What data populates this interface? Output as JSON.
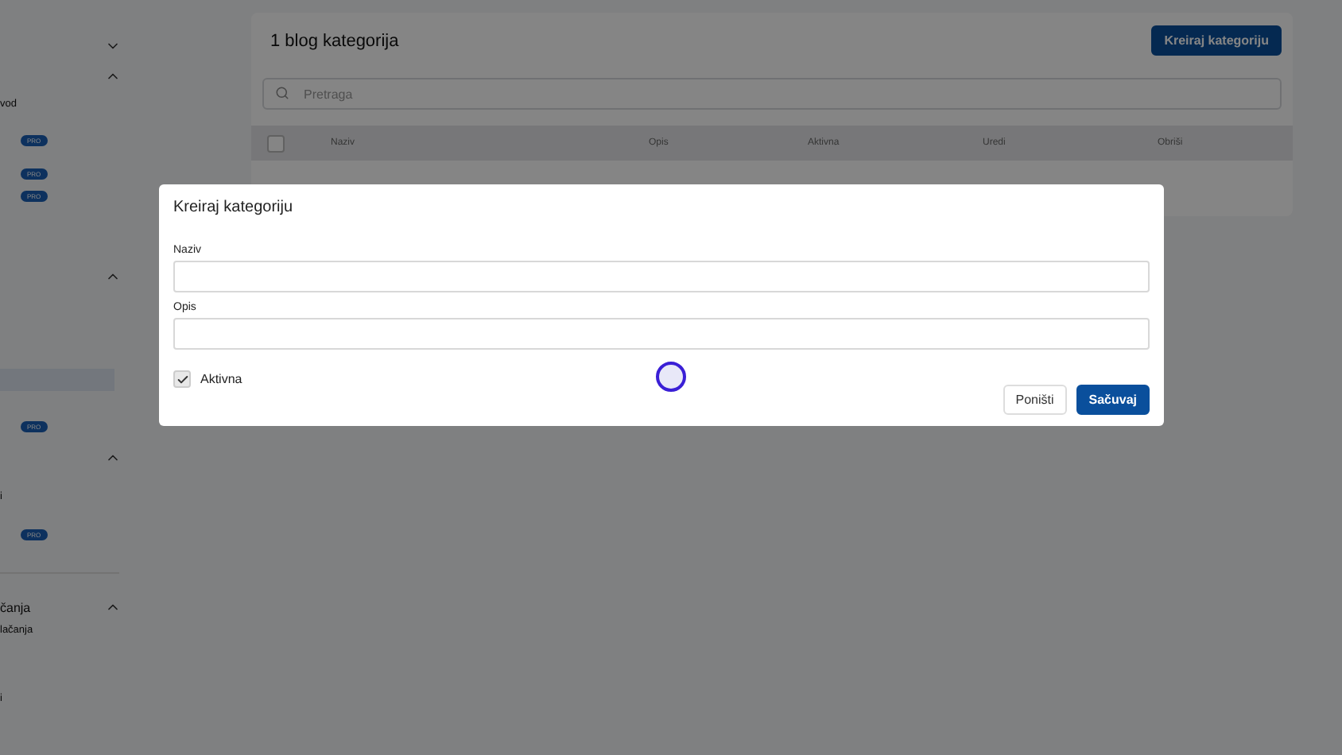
{
  "sidebar": {
    "items": [
      {
        "kind": "chevron",
        "expanded": false
      },
      {
        "kind": "chevron",
        "expanded": true
      },
      {
        "kind": "text",
        "text": "vod"
      },
      {
        "kind": "pro",
        "text": "PRO"
      },
      {
        "kind": "pro",
        "text": "PRO"
      },
      {
        "kind": "pro",
        "text": "PRO"
      },
      {
        "kind": "chevron",
        "expanded": true
      },
      {
        "kind": "highlight"
      },
      {
        "kind": "pro",
        "text": "PRO"
      },
      {
        "kind": "chevron",
        "expanded": true
      },
      {
        "kind": "text",
        "text": "i"
      },
      {
        "kind": "pro",
        "text": "PRO"
      },
      {
        "kind": "divider"
      },
      {
        "kind": "section",
        "text": "čanja"
      },
      {
        "kind": "text",
        "text": "lačanja"
      },
      {
        "kind": "text",
        "text": "i"
      }
    ]
  },
  "page": {
    "title": "1 blog kategorija",
    "create_button": "Kreiraj kategoriju",
    "search": {
      "placeholder": "Pretraga"
    },
    "table": {
      "select_all_checked": false,
      "columns": [
        "Naziv",
        "Opis",
        "Aktivna",
        "Uredi",
        "Obriši"
      ]
    }
  },
  "modal": {
    "title": "Kreiraj kategoriju",
    "fields": [
      {
        "label": "Naziv"
      },
      {
        "label": "Opis"
      }
    ],
    "active": {
      "label": "Aktivna",
      "checked": true
    },
    "buttons": [
      {
        "label": "Poništi",
        "kind": "secondary"
      },
      {
        "label": "Sačuvaj",
        "kind": "primary"
      }
    ]
  }
}
